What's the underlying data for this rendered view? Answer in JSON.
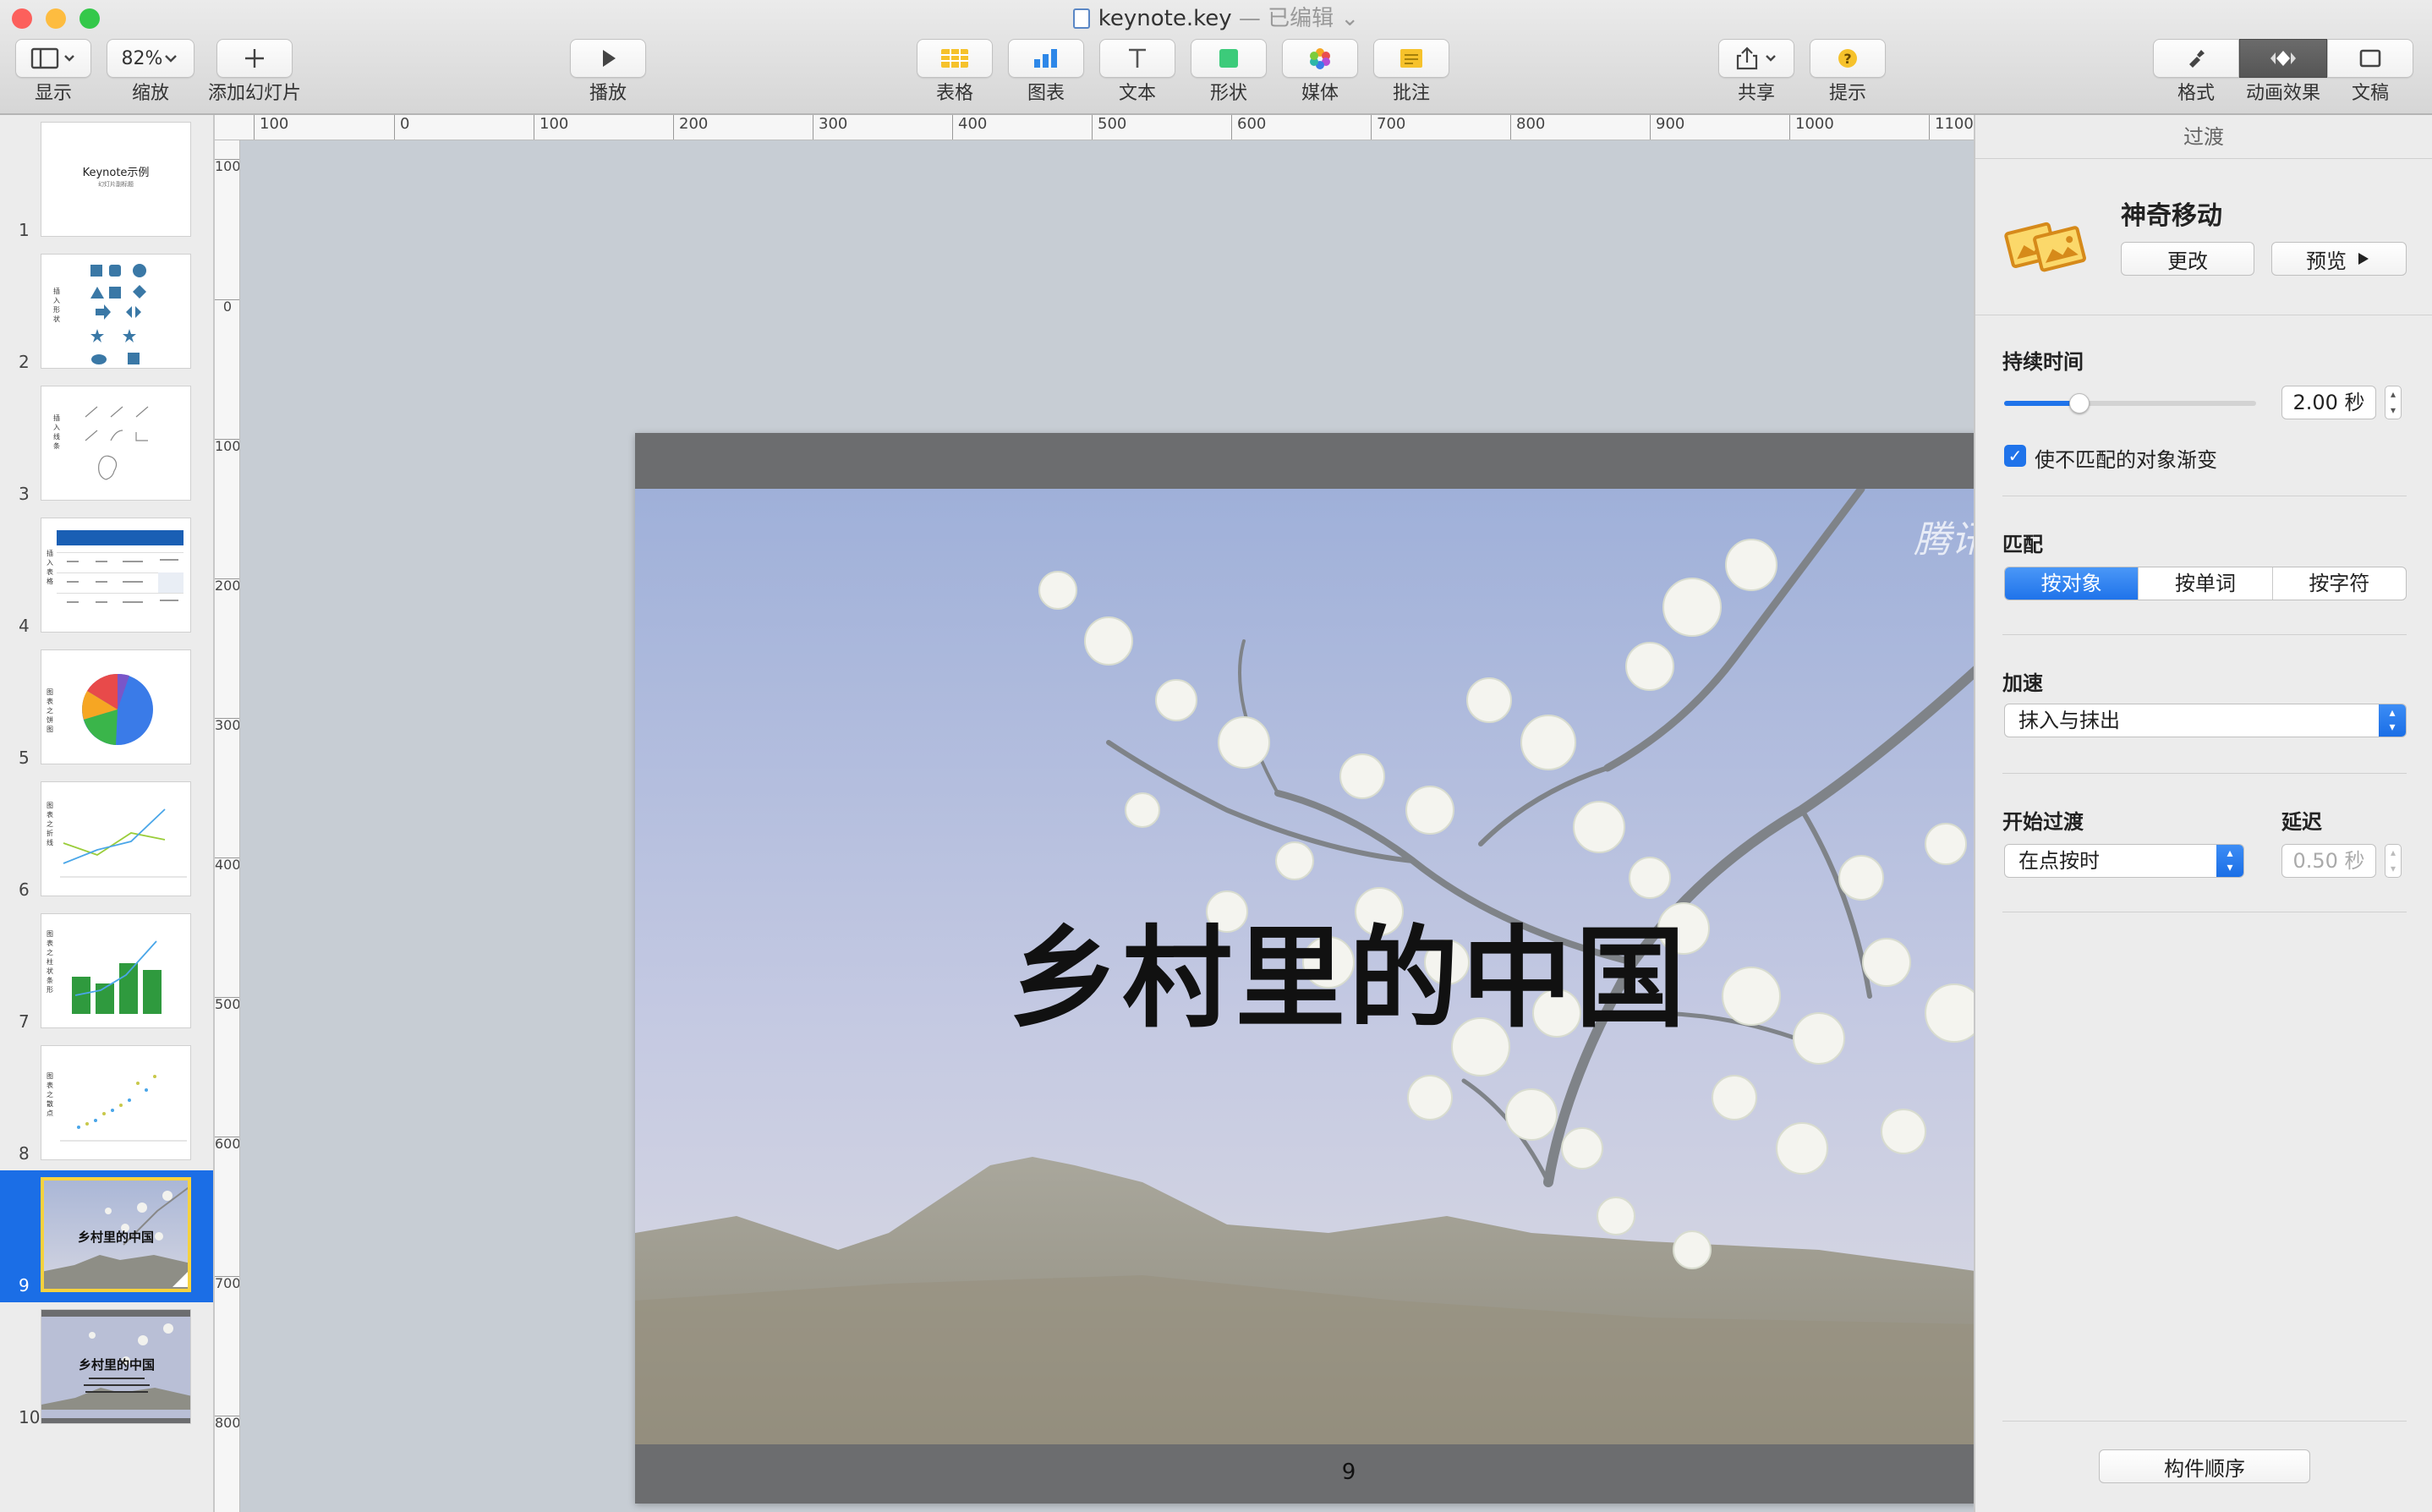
{
  "window": {
    "title": "keynote.key",
    "status": "— 已编辑 ⌄"
  },
  "toolbar": {
    "view_label": "显示",
    "zoom_value": "82%",
    "zoom_label": "缩放",
    "add_slide_label": "添加幻灯片",
    "play_label": "播放",
    "table_label": "表格",
    "chart_label": "图表",
    "text_label": "文本",
    "shape_label": "形状",
    "media_label": "媒体",
    "comment_label": "批注",
    "share_label": "共享",
    "tips_label": "提示",
    "format_label": "格式",
    "animate_label": "动画效果",
    "document_label": "文稿"
  },
  "navigator": {
    "slides": [
      {
        "num": "1",
        "title": "Keynote示例",
        "subtitle": "幻灯片副标题"
      },
      {
        "num": "2",
        "title": "插入形状"
      },
      {
        "num": "3",
        "title": "插入线条"
      },
      {
        "num": "4",
        "title": "插入表格"
      },
      {
        "num": "5",
        "title": "图表之饼图"
      },
      {
        "num": "6",
        "title": "图表之折线"
      },
      {
        "num": "7",
        "title": "图表之柱状条形"
      },
      {
        "num": "8",
        "title": "图表之散点"
      },
      {
        "num": "9",
        "title": "乡村里的中国"
      },
      {
        "num": "10",
        "title": "乡村里的中国"
      }
    ]
  },
  "rulers": {
    "top": [
      "100",
      "0",
      "100",
      "200",
      "300",
      "400",
      "500",
      "600",
      "700",
      "800",
      "900",
      "1000",
      "1100"
    ],
    "left": [
      "100",
      "0",
      "100",
      "200",
      "300",
      "400",
      "500",
      "600",
      "700",
      "800"
    ]
  },
  "slide": {
    "title": "乡村里的中国",
    "number": "9",
    "watermark": "腾讯视频"
  },
  "inspector": {
    "header": "过渡",
    "transition_name": "神奇移动",
    "change_label": "更改",
    "preview_label": "预览",
    "duration_title": "持续时间",
    "duration_value": "2.00 秒",
    "duration_slider_fraction": 0.3,
    "fade_checkbox_label": "使不匹配的对象渐变",
    "fade_checked": true,
    "match_title": "匹配",
    "match_options": [
      "按对象",
      "按单词",
      "按字符"
    ],
    "match_selected": "按对象",
    "accel_title": "加速",
    "accel_value": "抹入与抹出",
    "start_title": "开始过渡",
    "start_value": "在点按时",
    "delay_title": "延迟",
    "delay_value": "0.50 秒",
    "build_order_label": "构件顺序"
  },
  "colors": {
    "accent": "#1b6ee6",
    "selection_border": "#f7d23e",
    "slide_band": "#6c6d6f"
  }
}
